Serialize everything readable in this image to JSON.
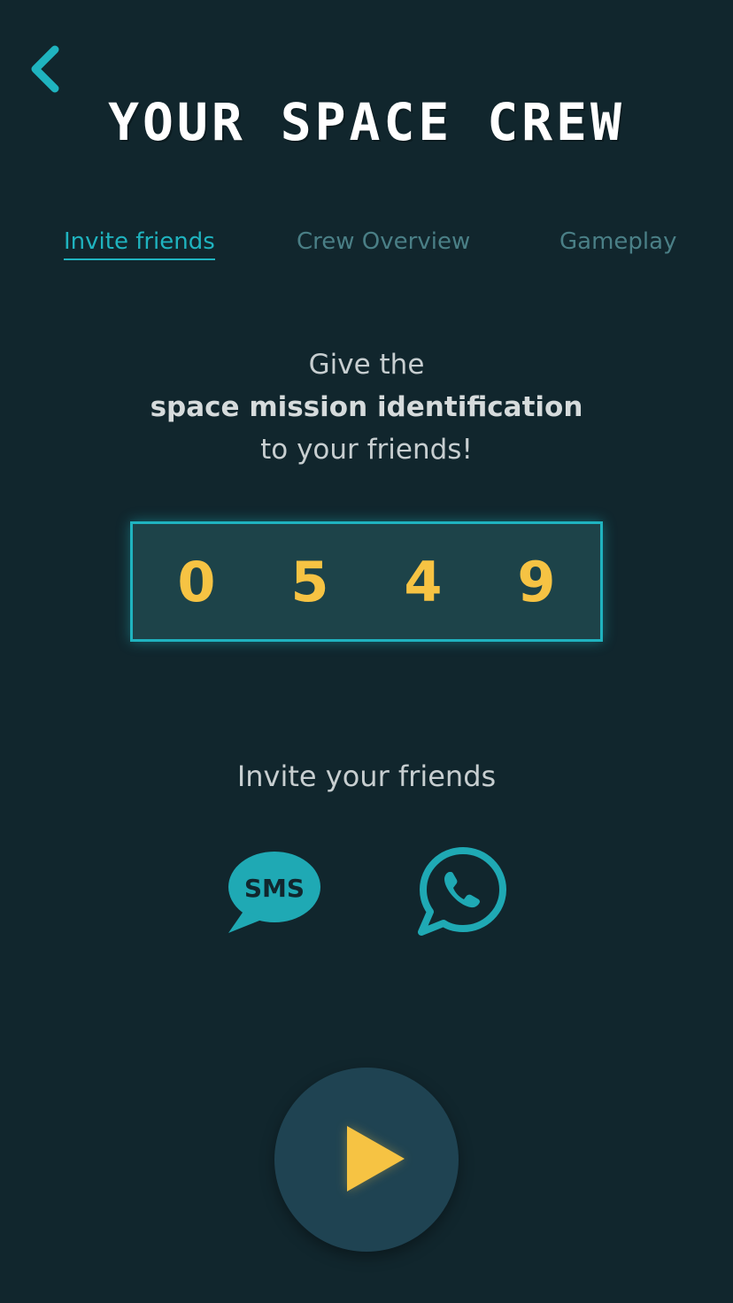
{
  "header": {
    "title": "YOUR SPACE CREW",
    "back_icon": "chevron-left-icon"
  },
  "tabs": [
    {
      "label": "Invite friends",
      "active": true
    },
    {
      "label": "Crew Overview",
      "active": false
    },
    {
      "label": "Gameplay",
      "active": false
    }
  ],
  "message": {
    "line1": "Give the",
    "line2": "space mission identification",
    "line3": "to your friends!"
  },
  "code": {
    "digits": [
      "0",
      "5",
      "4",
      "9"
    ]
  },
  "invite": {
    "label": "Invite your friends",
    "sms_text": "SMS",
    "sms_icon": "sms-bubble-icon",
    "whatsapp_icon": "whatsapp-icon"
  },
  "play": {
    "icon": "play-icon"
  },
  "colors": {
    "background": "#11262d",
    "accent": "#1fb3bf",
    "code_digit": "#f6c343",
    "play_button": "#1f4352"
  }
}
